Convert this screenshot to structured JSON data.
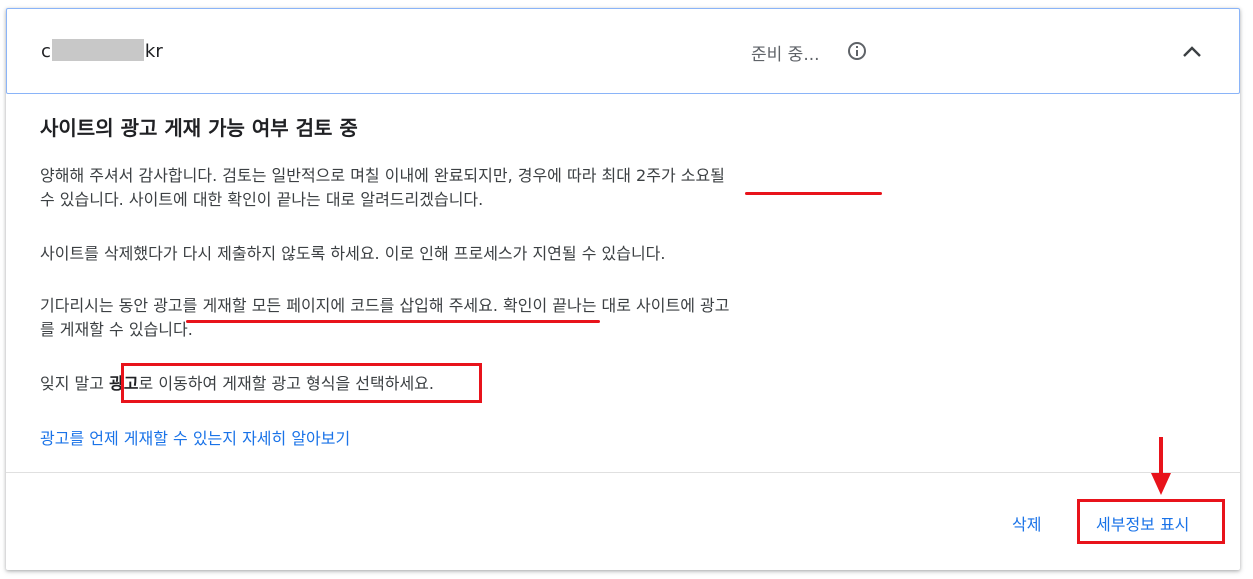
{
  "header": {
    "site_prefix": "c",
    "site_suffix": "kr",
    "status": "준비 중...",
    "info_icon": "info-icon",
    "expand_icon": "chevron-up-icon"
  },
  "body": {
    "title": "사이트의 광고 게재 가능 여부 검토 중",
    "p1_line1": "양해해 주셔서 감사합니다. 검토는 일반적으로 며칠 이내에 완료되지만, 경우에 따라 최대 2주가 소요될",
    "p1_line2": "수 있습니다. 사이트에 대한 확인이 끝나는 대로 알려드리겠습니다.",
    "p2": "사이트를 삭제했다가 다시 제출하지 않도록 하세요. 이로 인해 프로세스가 지연될 수 있습니다.",
    "p3_line1": "기다리시는 동안 광고를 게재할 모든 페이지에 코드를 삽입해 주세요. 확인이 끝나는 대로 사이트에 광고",
    "p3_line2": "를 게재할 수 있습니다.",
    "p4_before": "잊지 말고 ",
    "p4_bold": "광고",
    "p4_after": "로 이동하여 게재할 광고 형식을 선택하세요.",
    "learn_more": "광고를 언제 게재할 수 있는지 자세히 알아보기"
  },
  "actions": {
    "delete_label": "삭제",
    "details_label": "세부정보 표시"
  },
  "colors": {
    "accent": "#1a73e8",
    "annotation": "#e8131b",
    "header_border": "#8ab4f8"
  }
}
